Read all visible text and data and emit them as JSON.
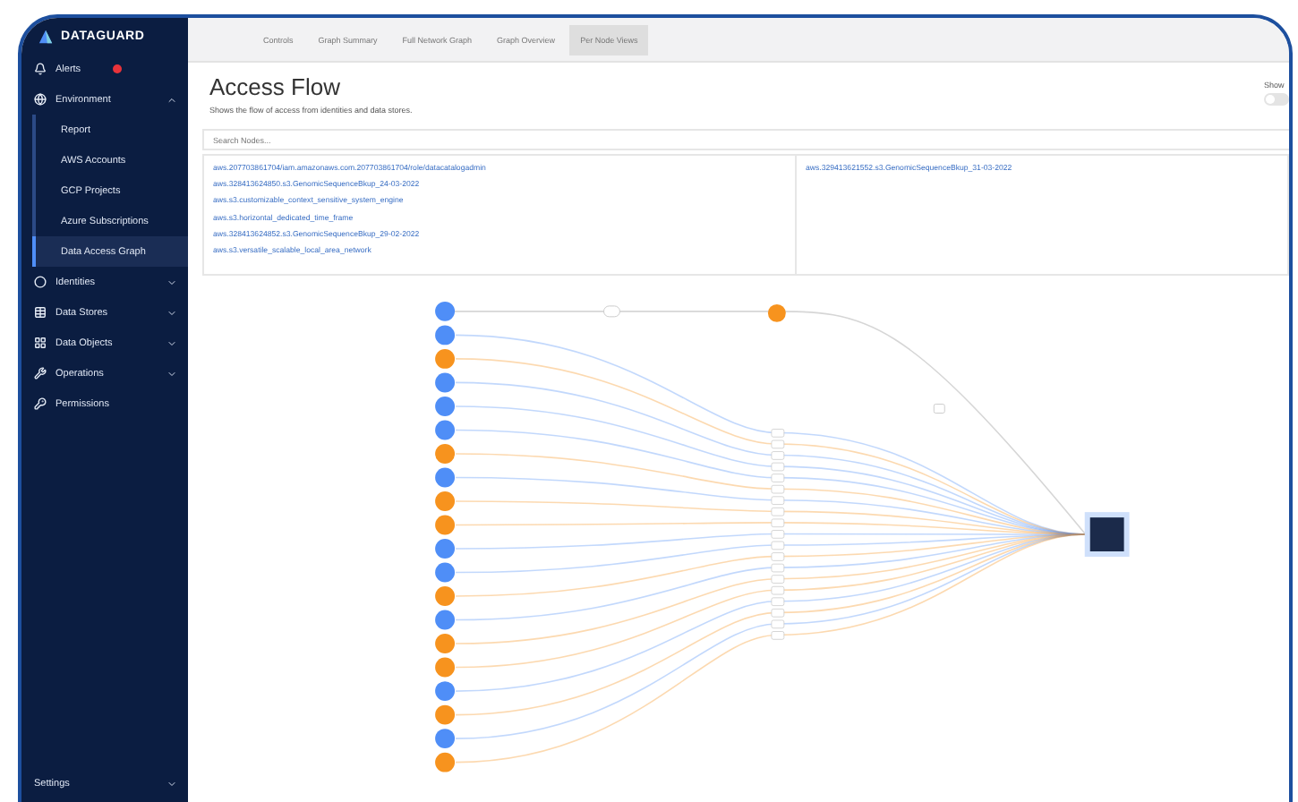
{
  "sidebar": {
    "logo": "DATAGUARD",
    "items": [
      {
        "label": "Alerts",
        "kind": "bell",
        "badge": true,
        "selected": false
      },
      {
        "label": "Environment",
        "kind": "globe",
        "expanded": true,
        "selected": false,
        "children": [
          {
            "label": "Report",
            "selected": false
          },
          {
            "label": "AWS Accounts",
            "selected": false
          },
          {
            "label": "GCP Projects",
            "selected": false
          },
          {
            "label": "Azure Subscriptions",
            "selected": false
          },
          {
            "label": "Data Access Graph",
            "selected": true
          }
        ]
      },
      {
        "label": "Identities",
        "kind": "circle",
        "expanded": false,
        "selected": false
      },
      {
        "label": "Data Stores",
        "kind": "table",
        "expanded": false,
        "selected": false
      },
      {
        "label": "Data Objects",
        "kind": "grid",
        "expanded": false,
        "selected": false
      },
      {
        "label": "Operations",
        "kind": "wrench",
        "expanded": false,
        "selected": false
      },
      {
        "label": "Permissions",
        "kind": "key",
        "selected": false
      }
    ],
    "footer": {
      "label": "Settings",
      "expanded": false
    }
  },
  "tabs": [
    {
      "label": "Controls",
      "selected": false
    },
    {
      "label": "Graph Summary",
      "selected": false
    },
    {
      "label": "Full Network Graph",
      "selected": false
    },
    {
      "label": "Graph Overview",
      "selected": false
    },
    {
      "label": "Per Node Views",
      "selected": true
    }
  ],
  "page": {
    "title": "Access Flow",
    "subtitle": "Shows the flow of access from identities and data stores.",
    "show_toggle": {
      "label": "Show",
      "on": false
    }
  },
  "search": {
    "placeholder": "Search Nodes..."
  },
  "node_list": {
    "column_1": [
      "aws.207703861704/iam.amazonaws.com.207703861704/role/datacatalogadmin",
      "aws.328413624850.s3.GenomicSequenceBkup_24-03-2022",
      "aws.s3.customizable_context_sensitive_system_engine",
      "aws.s3.horizontal_dedicated_time_frame",
      "aws.328413624852.s3.GenomicSequenceBkup_29-02-2022",
      "aws.s3.versatile_scalable_local_area_network"
    ],
    "column_2": [
      "aws.329413621552.s3.GenomicSequenceBkup_31-03-2022"
    ]
  },
  "graph": {
    "nodes": [
      {
        "color": "#4f8ef7"
      },
      {
        "color": "#4f8ef7"
      },
      {
        "color": "#f7931e"
      },
      {
        "color": "#4f8ef7"
      },
      {
        "color": "#4f8ef7"
      },
      {
        "color": "#4f8ef7"
      },
      {
        "color": "#f7931e"
      },
      {
        "color": "#4f8ef7"
      },
      {
        "color": "#f7931e"
      },
      {
        "color": "#f7931e"
      },
      {
        "color": "#4f8ef7"
      },
      {
        "color": "#4f8ef7"
      },
      {
        "color": "#f7931e"
      },
      {
        "color": "#4f8ef7"
      },
      {
        "color": "#f7931e"
      },
      {
        "color": "#f7931e"
      },
      {
        "color": "#4f8ef7"
      },
      {
        "color": "#f7931e"
      },
      {
        "color": "#4f8ef7"
      },
      {
        "color": "#f7931e"
      }
    ],
    "relay_node": {
      "color": "#f7931e"
    }
  }
}
